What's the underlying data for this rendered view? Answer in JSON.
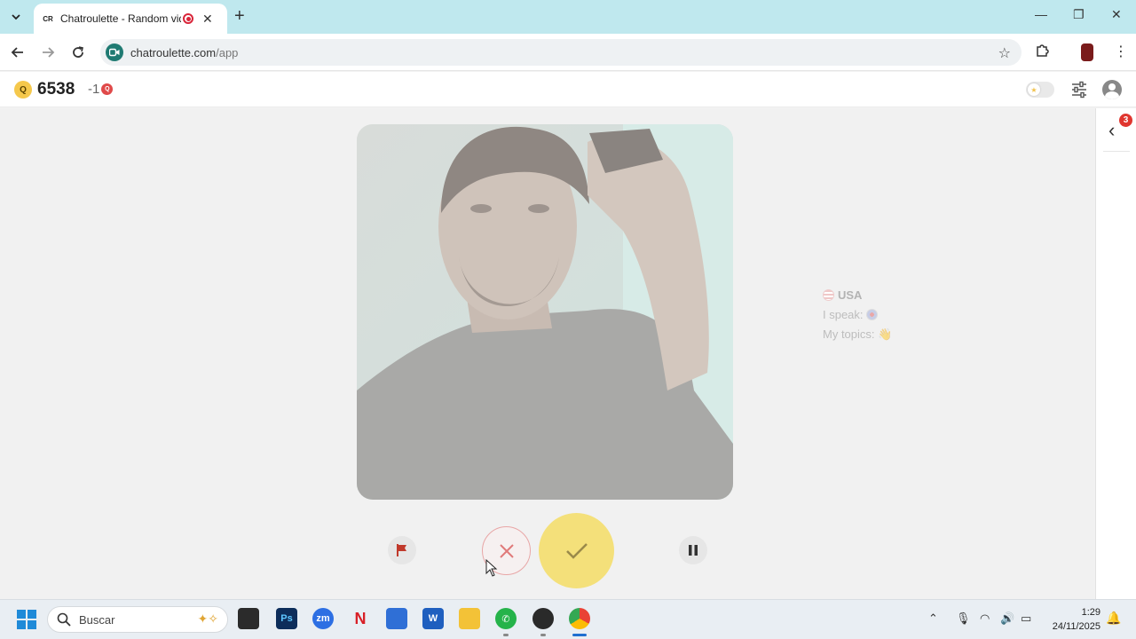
{
  "browser": {
    "tab_title": "Chatroulette - Random vide",
    "tab_favicon_text": "CR",
    "new_tab_symbol": "+",
    "url_domain": "chatroulette.com",
    "url_path": "/app",
    "window_controls": {
      "minimize": "—",
      "maximize": "❐",
      "close": "✕"
    }
  },
  "appbar": {
    "coin_letter": "Q",
    "coin_count": "6538",
    "delta": "-1",
    "delta_badge": "Q"
  },
  "side_panel": {
    "badge_count": "3"
  },
  "partner": {
    "country": "USA",
    "speak_label": "I speak:",
    "topics_label": "My topics:",
    "topics_emoji": "👋"
  },
  "taskbar": {
    "search_placeholder": "Buscar",
    "time": "1:29",
    "date": "24/11/2025",
    "apps": [
      "File Explorer (dark)",
      "Photoshop",
      "Zoom",
      "Netflix",
      "Microsoft Store",
      "Word",
      "File Explorer",
      "WhatsApp",
      "OBS",
      "Chrome"
    ]
  },
  "colors": {
    "tabbar_bg": "#bfe8ee",
    "accept": "#f4e07a",
    "skip_border": "#e8a6a6",
    "badge_red": "#e0362f"
  }
}
